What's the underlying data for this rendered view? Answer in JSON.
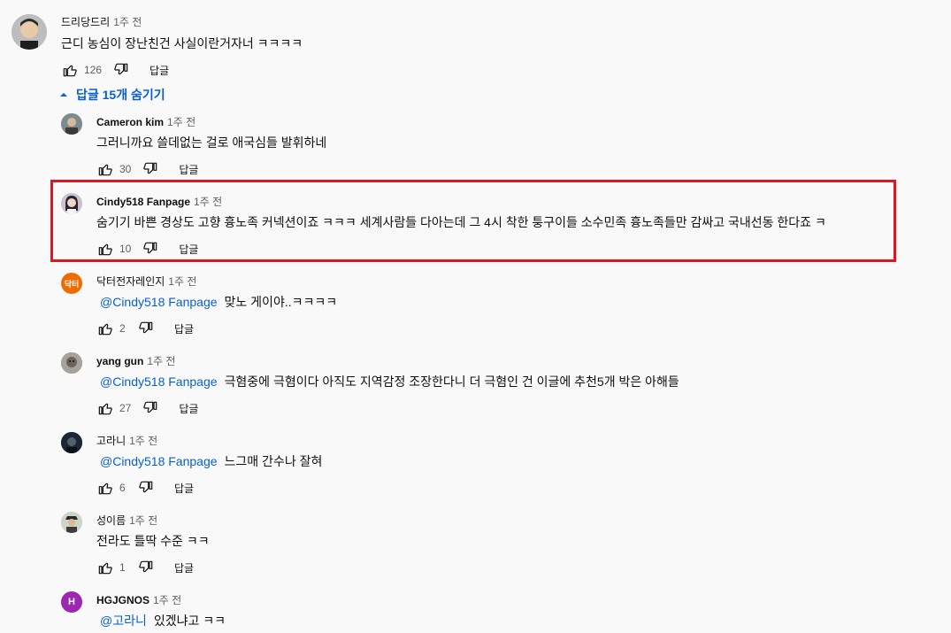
{
  "top_comment": {
    "author": "드리당드리",
    "time": "1주 전",
    "text": "근디 농심이 장난친건  사실이란거자너 ㅋㅋㅋㅋ",
    "likes": "126",
    "reply_label": "답글"
  },
  "replies_toggle": {
    "label": "답글 15개 숨기기"
  },
  "replies": [
    {
      "author": "Cameron kim",
      "time": "1주 전",
      "mention": "",
      "text": "그러니까요  쓸데없는 걸로 애국심들 발휘하네",
      "likes": "30",
      "reply_label": "답글"
    },
    {
      "author": "Cindy518 Fanpage",
      "time": "1주 전",
      "mention": "",
      "text": "숨기기 바쁜 경상도 고향 흉노족 커넥션이죠 ㅋㅋㅋ 세계사람들 다아는데 그 4시 착한 퉁구이들 소수민족 흉노족들만 감싸고 국내선동 한다죠 ㅋ",
      "likes": "10",
      "reply_label": "답글"
    },
    {
      "author": "닥터전자레인지",
      "time": "1주 전",
      "mention": "@Cindy518 Fanpage",
      "text": "맞노 게이야..ㅋㅋㅋㅋ",
      "likes": "2",
      "reply_label": "답글",
      "avatar_initial": "닥터"
    },
    {
      "author": "yang gun",
      "time": "1주 전",
      "mention": "@Cindy518 Fanpage",
      "text": "극혐중에 극혐이다 아직도 지역감정 조장한다니 더 극혐인 건 이글에 추천5개 박은 아해들",
      "likes": "27",
      "reply_label": "답글"
    },
    {
      "author": "고라니",
      "time": "1주 전",
      "mention": "@Cindy518 Fanpage",
      "text": "느그매 간수나 잘혀",
      "likes": "6",
      "reply_label": "답글"
    },
    {
      "author": "성이름",
      "time": "1주 전",
      "mention": "",
      "text": "전라도 틀딱 수준 ㅋㅋ",
      "likes": "1",
      "reply_label": "답글"
    },
    {
      "author": "HGJGNOS",
      "time": "1주 전",
      "mention": "@고라니",
      "text": "있겠냐고 ㅋㅋ",
      "avatar_initial": "H"
    }
  ],
  "colors": {
    "link": "#065fd4",
    "highlight_border": "#e2141c",
    "avatar_orange": "#ef6c00",
    "avatar_purple": "#9c27b0"
  },
  "icons": [
    "thumb-up-icon",
    "thumb-down-icon",
    "caret-up-icon"
  ]
}
